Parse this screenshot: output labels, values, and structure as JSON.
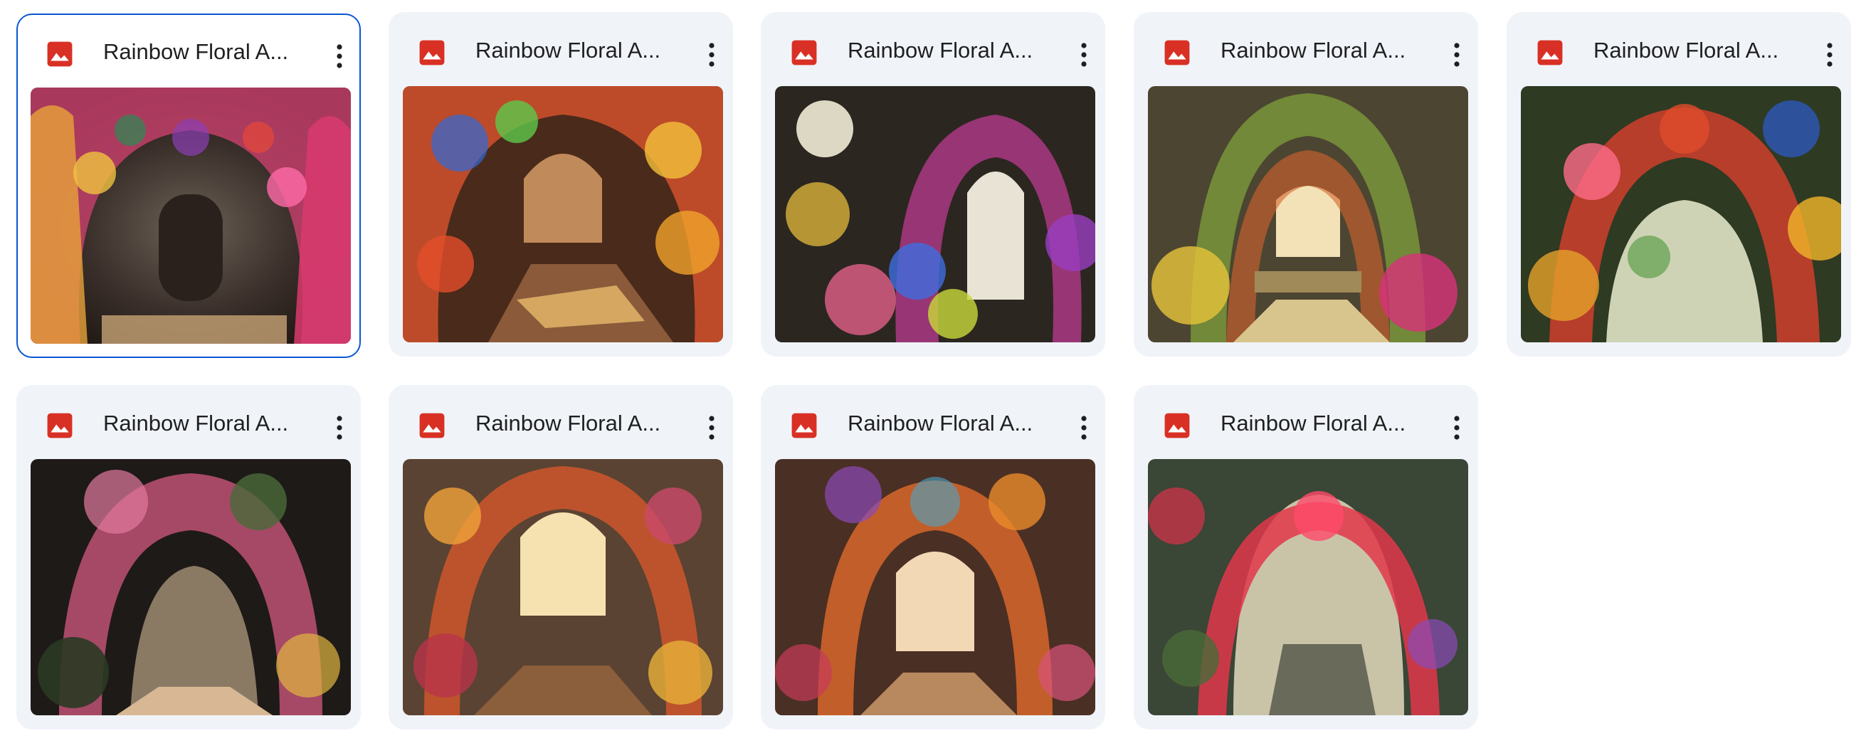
{
  "files": [
    {
      "name": "Rainbow Floral A...",
      "icon": "image-file-icon",
      "selected": true
    },
    {
      "name": "Rainbow Floral A...",
      "icon": "image-file-icon",
      "selected": false
    },
    {
      "name": "Rainbow Floral A...",
      "icon": "image-file-icon",
      "selected": false
    },
    {
      "name": "Rainbow Floral A...",
      "icon": "image-file-icon",
      "selected": false
    },
    {
      "name": "Rainbow Floral A...",
      "icon": "image-file-icon",
      "selected": false
    },
    {
      "name": "Rainbow Floral A...",
      "icon": "image-file-icon",
      "selected": false
    },
    {
      "name": "Rainbow Floral A...",
      "icon": "image-file-icon",
      "selected": false
    },
    {
      "name": "Rainbow Floral A...",
      "icon": "image-file-icon",
      "selected": false
    },
    {
      "name": "Rainbow Floral A...",
      "icon": "image-file-icon",
      "selected": false
    }
  ],
  "colors": {
    "card_bg": "#f0f4f9",
    "selected_border": "#0b57d0",
    "icon_red": "#d93025",
    "text": "#1f1f1f"
  }
}
